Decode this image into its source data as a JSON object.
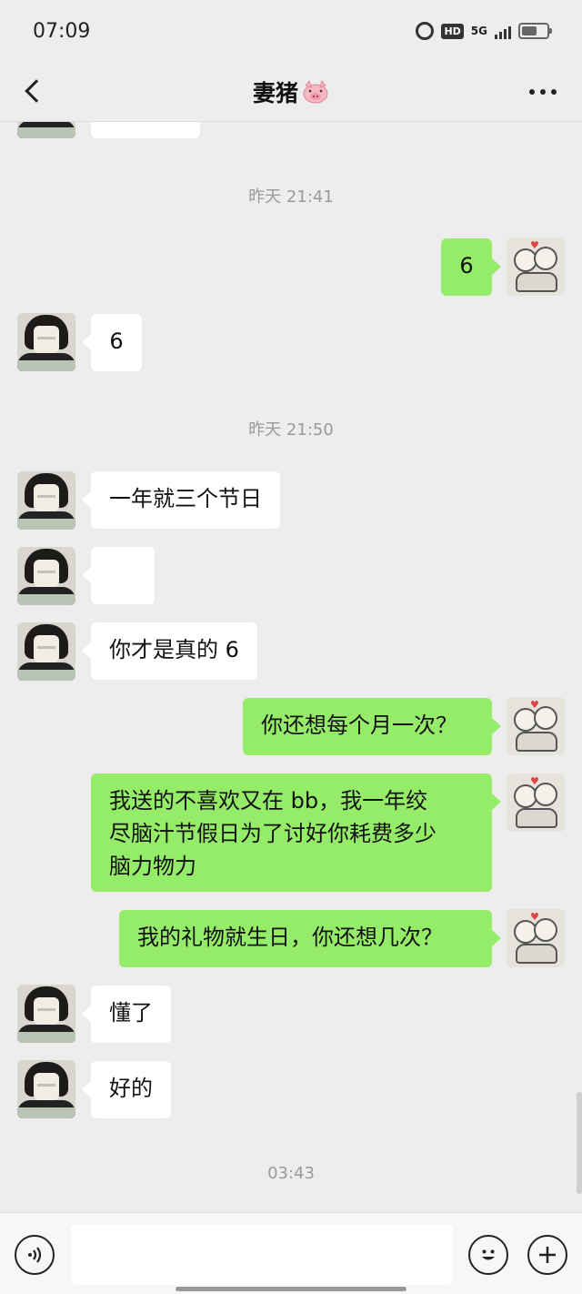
{
  "status_bar": {
    "time": "07:09",
    "network": "5G",
    "hd_label": "HD"
  },
  "nav": {
    "title": "妻猪",
    "title_emoji": "pig-face-icon"
  },
  "messages": {
    "partial": {
      "text": ""
    },
    "ts1": "昨天 21:41",
    "m1": {
      "side": "right",
      "text": "6"
    },
    "m2": {
      "side": "left",
      "text": "6"
    },
    "ts2": "昨天 21:50",
    "m3": {
      "side": "left",
      "text": "一年就三个节日"
    },
    "m4": {
      "side": "left",
      "type": "emoji",
      "emoji": "smiley-emoji-icon"
    },
    "m5": {
      "side": "left",
      "text": "你才是真的 6"
    },
    "m6": {
      "side": "right",
      "text": "你还想每个月一次？"
    },
    "m7": {
      "side": "right",
      "text": "我送的不喜欢又在 bb，我一年绞\n尽脑汁节假日为了讨好你耗费多少\n脑力物力"
    },
    "m8": {
      "side": "right",
      "text": "我的礼物就生日，你还想几次？"
    },
    "m9": {
      "side": "left",
      "text": "懂了"
    },
    "m10": {
      "side": "left",
      "text": "好的"
    },
    "ts3": "03:43"
  },
  "input_bar": {
    "placeholder": ""
  },
  "colors": {
    "background": "#ededed",
    "sent_bubble": "#95ec69",
    "received_bubble": "#ffffff",
    "timestamp": "#9a9a9a"
  }
}
